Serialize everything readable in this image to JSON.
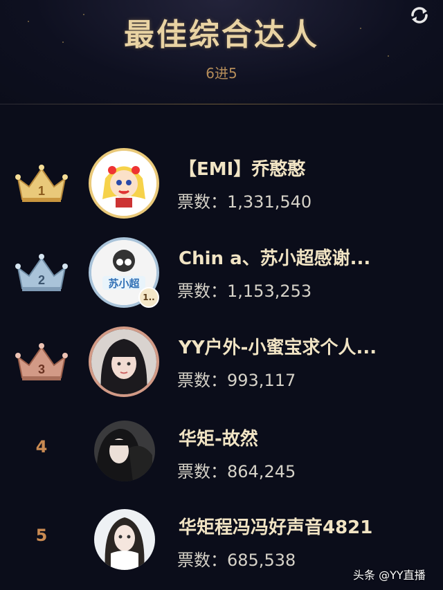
{
  "header": {
    "title": "最佳综合达人",
    "subtitle": "6进5"
  },
  "colors": {
    "gold": "#e9c97a",
    "silver": "#a9c3d9",
    "bronze": "#d29a86",
    "rank_text": "#c98a52",
    "name_text": "#f1e4c4"
  },
  "ranking": [
    {
      "rank": "1",
      "name": "【EMI】乔憨憨",
      "votes_label": "票数：",
      "votes": "1,331,540",
      "crown": "gold-crown-icon"
    },
    {
      "rank": "2",
      "name": "Chin a、苏小超感谢...",
      "votes_label": "票数：",
      "votes": "1,153,253",
      "crown": "silver-crown-icon",
      "badge": "1.."
    },
    {
      "rank": "3",
      "name": "YY户外-小蜜宝求个人...",
      "votes_label": "票数：",
      "votes": "993,117",
      "crown": "bronze-crown-icon"
    },
    {
      "rank": "4",
      "name": "华矩-故然",
      "votes_label": "票数：",
      "votes": "864,245"
    },
    {
      "rank": "5",
      "name": "华矩程冯冯好声音4821",
      "votes_label": "票数：",
      "votes": "685,538"
    }
  ],
  "watermark": "头条 @YY直播"
}
